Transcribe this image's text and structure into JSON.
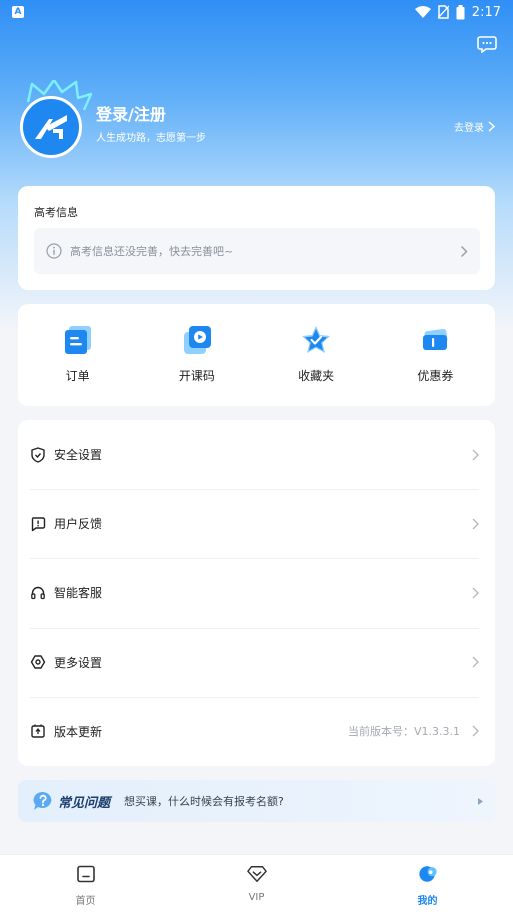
{
  "status_bar": {
    "time": "2:17",
    "app_badge": "A"
  },
  "profile": {
    "title": "登录/注册",
    "subtitle": "人生成功路，志愿第一步",
    "go_login": "去登录"
  },
  "gaokao": {
    "title": "高考信息",
    "prompt": "高考信息还没完善，快去完善吧~"
  },
  "quick_actions": [
    {
      "label": "订单",
      "icon": "order-icon"
    },
    {
      "label": "开课码",
      "icon": "course-code-icon"
    },
    {
      "label": "收藏夹",
      "icon": "favorites-icon"
    },
    {
      "label": "优惠券",
      "icon": "coupon-icon"
    }
  ],
  "menu": {
    "items": [
      {
        "label": "安全设置",
        "icon": "shield-icon"
      },
      {
        "label": "用户反馈",
        "icon": "feedback-icon"
      },
      {
        "label": "智能客服",
        "icon": "headset-icon"
      },
      {
        "label": "更多设置",
        "icon": "settings-icon"
      },
      {
        "label": "版本更新",
        "icon": "update-icon",
        "value": "当前版本号：V1.3.3.1"
      }
    ]
  },
  "faq": {
    "title": "常见问题",
    "question": "想买课，什么时候会有报考名额?"
  },
  "tabbar": {
    "tabs": [
      {
        "label": "首页",
        "icon": "home-icon"
      },
      {
        "label": "VIP",
        "icon": "vip-icon"
      },
      {
        "label": "我的",
        "icon": "profile-icon",
        "active": true
      }
    ]
  },
  "colors": {
    "primary": "#1e88f0",
    "hero_top": "#2f8ff5",
    "background": "#f3f5f9"
  }
}
